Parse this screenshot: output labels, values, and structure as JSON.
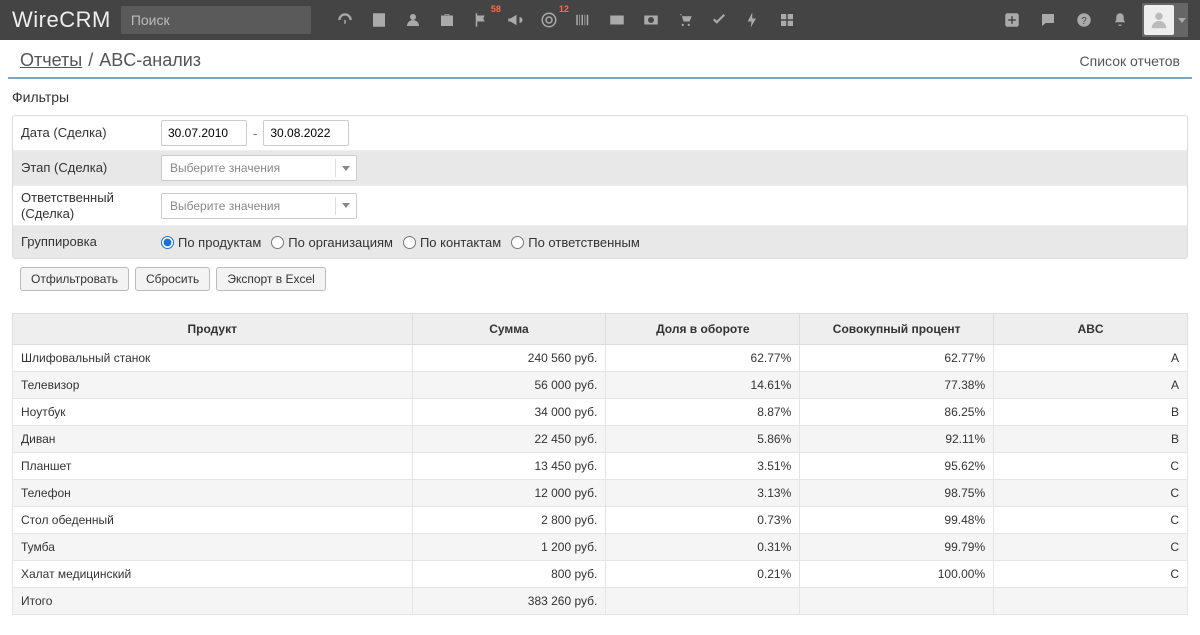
{
  "brand": "WireCRM",
  "search_placeholder": "Поиск",
  "nav_badges": {
    "flag": "58",
    "circle": "12"
  },
  "breadcrumb": {
    "root": "Отчеты",
    "current": "ABC-анализ",
    "sep": "/"
  },
  "right_link": "Список отчетов",
  "filters": {
    "title": "Фильтры",
    "date_label": "Дата (Сделка)",
    "date_from": "30.07.2010",
    "date_to": "30.08.2022",
    "date_sep": "-",
    "stage_label": "Этап (Сделка)",
    "stage_placeholder": "Выберите значения",
    "responsible_label": "Ответственный (Сделка)",
    "responsible_placeholder": "Выберите значения",
    "group_label": "Группировка",
    "group_options": [
      "По продуктам",
      "По организациям",
      "По контактам",
      "По ответственным"
    ]
  },
  "buttons": {
    "filter": "Отфильтровать",
    "reset": "Сбросить",
    "export": "Экспорт в Excel"
  },
  "table": {
    "headers": [
      "Продукт",
      "Сумма",
      "Доля в обороте",
      "Совокупный процент",
      "ABC"
    ],
    "rows": [
      {
        "product": "Шлифовальный станок",
        "sum": "240 560 руб.",
        "share": "62.77%",
        "cum": "62.77%",
        "abc": "A"
      },
      {
        "product": "Телевизор",
        "sum": "56 000 руб.",
        "share": "14.61%",
        "cum": "77.38%",
        "abc": "A"
      },
      {
        "product": "Ноутбук",
        "sum": "34 000 руб.",
        "share": "8.87%",
        "cum": "86.25%",
        "abc": "B"
      },
      {
        "product": "Диван",
        "sum": "22 450 руб.",
        "share": "5.86%",
        "cum": "92.11%",
        "abc": "B"
      },
      {
        "product": "Планшет",
        "sum": "13 450 руб.",
        "share": "3.51%",
        "cum": "95.62%",
        "abc": "C"
      },
      {
        "product": "Телефон",
        "sum": "12 000 руб.",
        "share": "3.13%",
        "cum": "98.75%",
        "abc": "C"
      },
      {
        "product": "Стол обеденный",
        "sum": "2 800 руб.",
        "share": "0.73%",
        "cum": "99.48%",
        "abc": "C"
      },
      {
        "product": "Тумба",
        "sum": "1 200 руб.",
        "share": "0.31%",
        "cum": "99.79%",
        "abc": "C"
      },
      {
        "product": "Халат медицинский",
        "sum": "800 руб.",
        "share": "0.21%",
        "cum": "100.00%",
        "abc": "C"
      }
    ],
    "footer": {
      "label": "Итого",
      "sum": "383 260 руб."
    }
  },
  "chart_data": {
    "type": "table",
    "title": "ABC-анализ",
    "columns": [
      "Продукт",
      "Сумма (руб.)",
      "Доля в обороте (%)",
      "Совокупный процент (%)",
      "ABC"
    ],
    "rows": [
      [
        "Шлифовальный станок",
        240560,
        62.77,
        62.77,
        "A"
      ],
      [
        "Телевизор",
        56000,
        14.61,
        77.38,
        "A"
      ],
      [
        "Ноутбук",
        34000,
        8.87,
        86.25,
        "B"
      ],
      [
        "Диван",
        22450,
        5.86,
        92.11,
        "B"
      ],
      [
        "Планшет",
        13450,
        3.51,
        95.62,
        "C"
      ],
      [
        "Телефон",
        12000,
        3.13,
        98.75,
        "C"
      ],
      [
        "Стол обеденный",
        2800,
        0.73,
        99.48,
        "C"
      ],
      [
        "Тумба",
        1200,
        0.31,
        99.79,
        "C"
      ],
      [
        "Халат медицинский",
        800,
        0.21,
        100.0,
        "C"
      ]
    ],
    "total_sum": 383260
  }
}
